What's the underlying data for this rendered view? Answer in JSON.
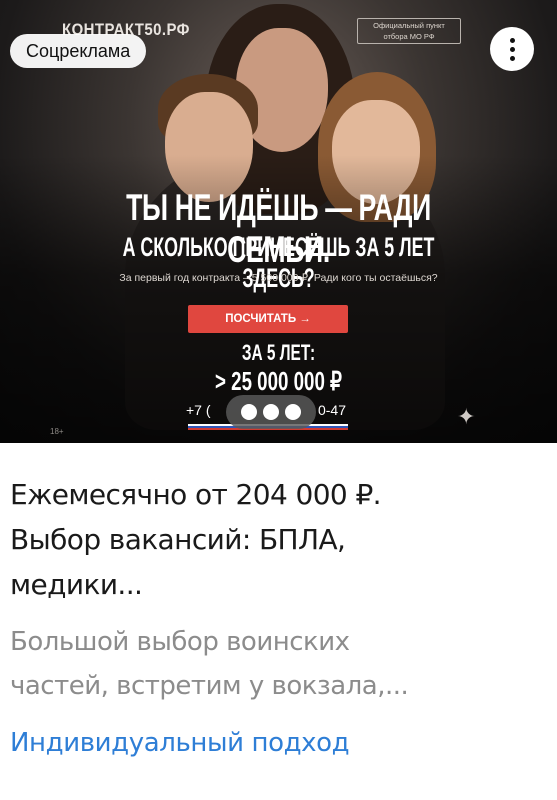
{
  "banner": {
    "brand": "КОНТРАКТ50.РФ",
    "soc_label": "Соцреклама",
    "official_line1": "Официальный пункт",
    "official_line2": "отбора МО РФ",
    "headline1": "ТЫ НЕ ИДЁШЬ — РАДИ СЕМЬИ.",
    "headline2": "А СКОЛЬКО ПРИНЕСЁШЬ ЗА 5 ЛЕТ ЗДЕСЬ?",
    "subline": "За первый год контракта – 5 500 000 ₽. Ради кого ты остаёшься?",
    "button_label": "ПОСЧИТАТЬ →",
    "years_label": "ЗА 5 ЛЕТ:",
    "amount": "> 25 000 000 ₽",
    "phone_left": "+7 (",
    "phone_right": "0-47",
    "age_rating": "18+",
    "flag_colors": [
      "#ffffff",
      "#2f56b8",
      "#d23a31"
    ]
  },
  "card": {
    "title_line1": "Ежемесячно от 204 000 ₽.",
    "title_line2": "Выбор вакансий: БПЛА,",
    "title_line3": "медики...",
    "desc_line1": "Большой выбор воинских",
    "desc_line2": "частей, встретим у вокзала,...",
    "cta": "Индивидуальный подход"
  },
  "icons": {
    "menu": "more-vertical-icon",
    "sparkle": "sparkle-icon"
  }
}
